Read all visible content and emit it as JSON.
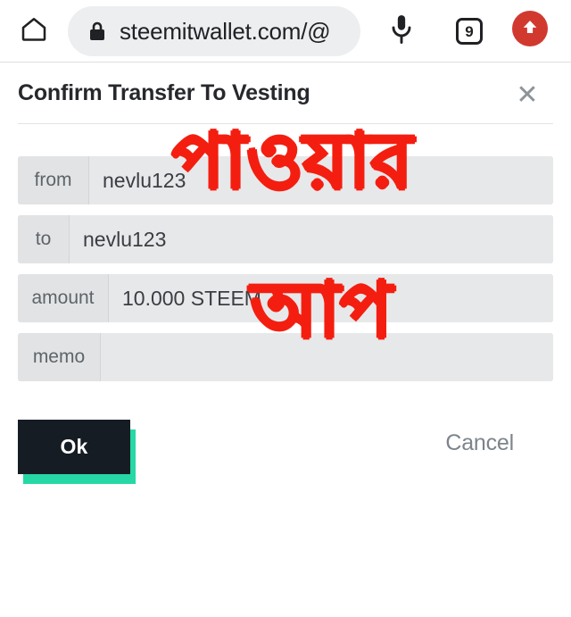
{
  "browser": {
    "home_icon": "home-icon",
    "lock_icon": "lock-icon",
    "url": "steemitwallet.com/@",
    "mic_icon": "microphone-icon",
    "tab_count": "9",
    "profile_icon": "up-arrow-icon"
  },
  "dialog": {
    "title": "Confirm Transfer To Vesting",
    "close_label": "✕",
    "fields": [
      {
        "label": "from",
        "value": "nevlu123"
      },
      {
        "label": "to",
        "value": "nevlu123"
      },
      {
        "label": "amount",
        "value": "10.000 STEEM"
      },
      {
        "label": "memo",
        "value": ""
      }
    ],
    "ok_label": "Ok",
    "cancel_label": "Cancel"
  },
  "overlay": {
    "line1": "পাওয়ার",
    "line2": "আপ",
    "color": "#f41e10"
  },
  "colors": {
    "accent_teal": "#26d8a5",
    "ok_dark": "#151c24",
    "field_bg": "#e7e8ea",
    "label_bg": "#e2e3e5",
    "profile_red": "#d1392f"
  }
}
